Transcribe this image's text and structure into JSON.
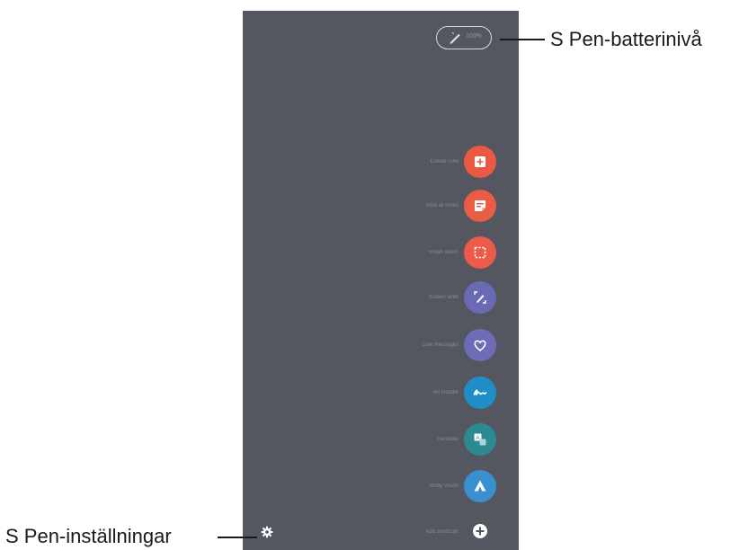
{
  "callouts": {
    "battery": "S Pen-batterinivå",
    "settings": "S Pen-inställningar"
  },
  "battery": {
    "level_text": "100%",
    "icon": "pen-icon"
  },
  "menu": {
    "items": [
      {
        "label": "Create note",
        "icon": "create-note-icon",
        "color": "#ea5a42"
      },
      {
        "label": "View all notes",
        "icon": "notes-icon",
        "color": "#e85d44"
      },
      {
        "label": "Smart select",
        "icon": "smart-select-icon",
        "color": "#ec5a4a"
      },
      {
        "label": "Screen write",
        "icon": "screen-write-icon",
        "color": "#6a69b4"
      },
      {
        "label": "Live messages",
        "icon": "live-messages-icon",
        "color": "#6e6cb8"
      },
      {
        "label": "AR Doodle",
        "icon": "ar-doodle-icon",
        "color": "#1f8ec7"
      },
      {
        "label": "Translate",
        "icon": "translate-icon",
        "color": "#2c8a93"
      },
      {
        "label": "Bixby Vision",
        "icon": "bixby-vision-icon",
        "color": "#3a8fd1"
      }
    ],
    "add_label": "Add shortcuts",
    "settings_icon": "gear-icon",
    "add_icon": "plus-icon"
  },
  "colors": {
    "screen_background": "#545760",
    "text_dark": "#1a1a1a"
  }
}
